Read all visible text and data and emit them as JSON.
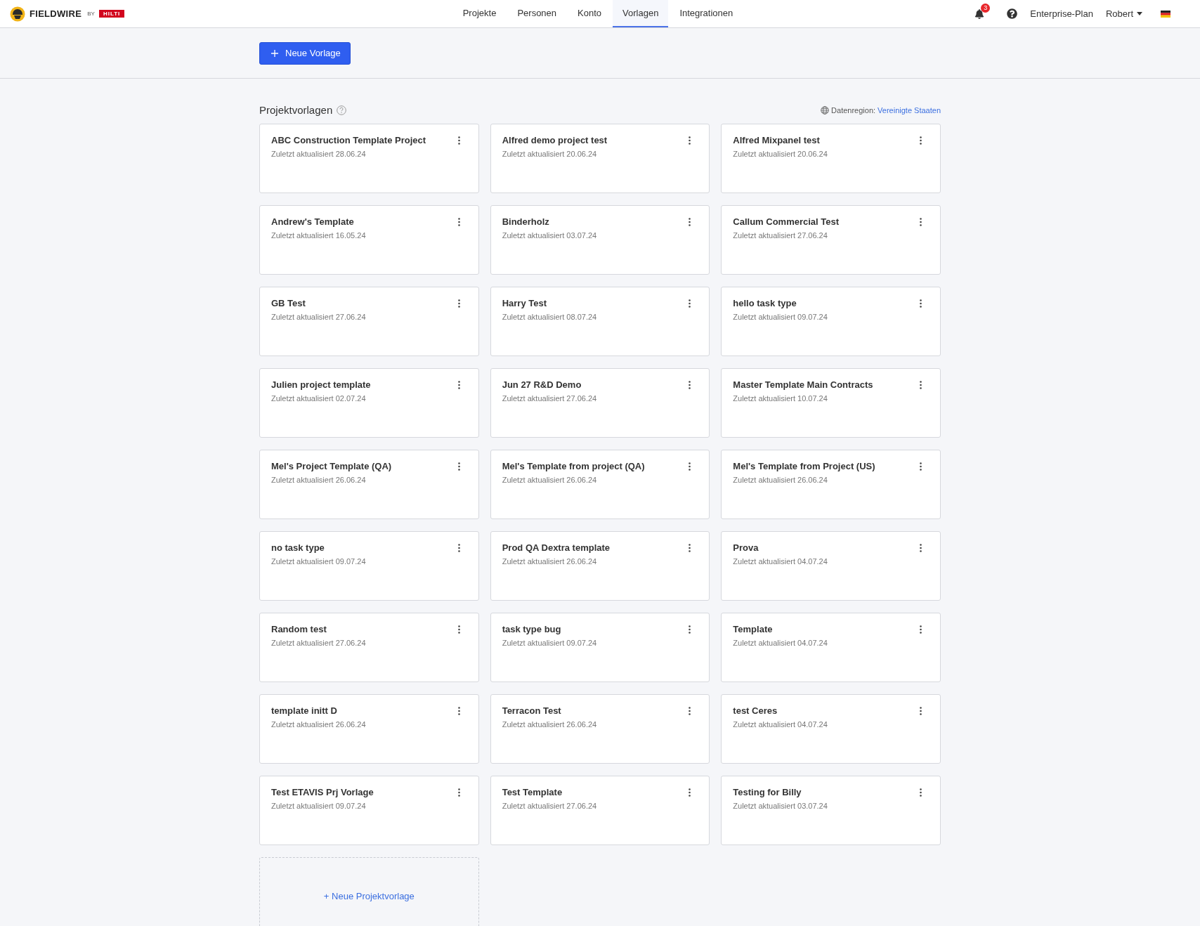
{
  "header": {
    "logo": {
      "brand": "FIELDWIRE",
      "by": "BY",
      "partner": "HILTI"
    },
    "nav": [
      {
        "label": "Projekte",
        "selected": false
      },
      {
        "label": "Personen",
        "selected": false
      },
      {
        "label": "Konto",
        "selected": false
      },
      {
        "label": "Vorlagen",
        "selected": true
      },
      {
        "label": "Integrationen",
        "selected": false
      }
    ],
    "notification_count": "3",
    "plan": "Enterprise-Plan",
    "user": "Robert"
  },
  "toolbar": {
    "new_button": "Neue Vorlage"
  },
  "section": {
    "title": "Projektvorlagen",
    "region_label": "Datenregion:",
    "region_value": "Vereinigte Staaten"
  },
  "templates": [
    {
      "name": "ABC Construction Template Project",
      "updated": "Zuletzt aktualisiert 28.06.24"
    },
    {
      "name": "Alfred demo project test",
      "updated": "Zuletzt aktualisiert 20.06.24"
    },
    {
      "name": "Alfred Mixpanel test",
      "updated": "Zuletzt aktualisiert 20.06.24"
    },
    {
      "name": "Andrew's Template",
      "updated": "Zuletzt aktualisiert 16.05.24"
    },
    {
      "name": "Binderholz",
      "updated": "Zuletzt aktualisiert 03.07.24"
    },
    {
      "name": "Callum Commercial Test",
      "updated": "Zuletzt aktualisiert 27.06.24"
    },
    {
      "name": "GB Test",
      "updated": "Zuletzt aktualisiert 27.06.24"
    },
    {
      "name": "Harry Test",
      "updated": "Zuletzt aktualisiert 08.07.24"
    },
    {
      "name": "hello task type",
      "updated": "Zuletzt aktualisiert 09.07.24"
    },
    {
      "name": "Julien project template",
      "updated": "Zuletzt aktualisiert 02.07.24"
    },
    {
      "name": "Jun 27 R&D Demo",
      "updated": "Zuletzt aktualisiert 27.06.24"
    },
    {
      "name": "Master Template Main Contracts",
      "updated": "Zuletzt aktualisiert 10.07.24"
    },
    {
      "name": "Mel's Project Template (QA)",
      "updated": "Zuletzt aktualisiert 26.06.24"
    },
    {
      "name": "Mel's Template from project (QA)",
      "updated": "Zuletzt aktualisiert 26.06.24"
    },
    {
      "name": "Mel's Template from Project (US)",
      "updated": "Zuletzt aktualisiert 26.06.24"
    },
    {
      "name": "no task type",
      "updated": "Zuletzt aktualisiert 09.07.24"
    },
    {
      "name": "Prod QA Dextra template",
      "updated": "Zuletzt aktualisiert 26.06.24"
    },
    {
      "name": "Prova",
      "updated": "Zuletzt aktualisiert 04.07.24"
    },
    {
      "name": "Random test",
      "updated": "Zuletzt aktualisiert 27.06.24"
    },
    {
      "name": "task type bug",
      "updated": "Zuletzt aktualisiert 09.07.24"
    },
    {
      "name": "Template",
      "updated": "Zuletzt aktualisiert 04.07.24"
    },
    {
      "name": "template initt D",
      "updated": "Zuletzt aktualisiert 26.06.24"
    },
    {
      "name": "Terracon Test",
      "updated": "Zuletzt aktualisiert 26.06.24"
    },
    {
      "name": "test Ceres",
      "updated": "Zuletzt aktualisiert 04.07.24"
    },
    {
      "name": "Test ETAVIS Prj Vorlage",
      "updated": "Zuletzt aktualisiert 09.07.24"
    },
    {
      "name": "Test Template",
      "updated": "Zuletzt aktualisiert 27.06.24"
    },
    {
      "name": "Testing for Billy",
      "updated": "Zuletzt aktualisiert 03.07.24"
    }
  ],
  "new_template_card": "+ Neue Projektvorlage"
}
